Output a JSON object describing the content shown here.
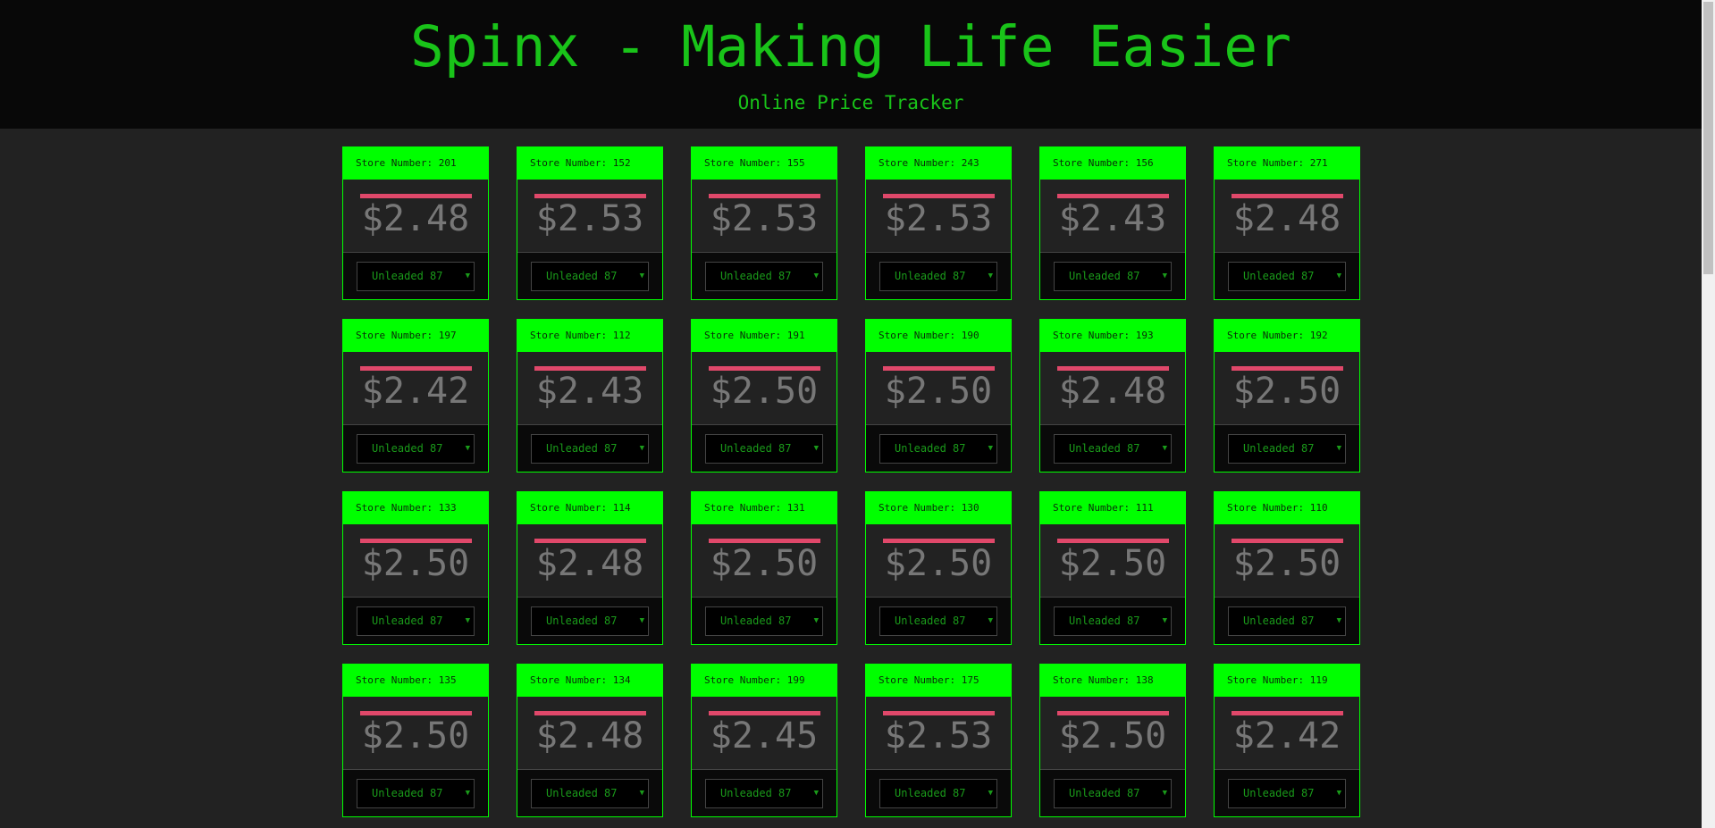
{
  "header": {
    "title": "Spinx - Making Life Easier",
    "subtitle": "Online Price Tracker"
  },
  "colors": {
    "accent": "#00ff00",
    "price_bar": "#e0486a",
    "background": "#222222"
  },
  "store_label": "Store Number: ",
  "stores": [
    {
      "number": "201",
      "price": "$2.48",
      "fuel": "Unleaded 87"
    },
    {
      "number": "152",
      "price": "$2.53",
      "fuel": "Unleaded 87"
    },
    {
      "number": "155",
      "price": "$2.53",
      "fuel": "Unleaded 87"
    },
    {
      "number": "243",
      "price": "$2.53",
      "fuel": "Unleaded 87"
    },
    {
      "number": "156",
      "price": "$2.43",
      "fuel": "Unleaded 87"
    },
    {
      "number": "271",
      "price": "$2.48",
      "fuel": "Unleaded 87"
    },
    {
      "number": "197",
      "price": "$2.42",
      "fuel": "Unleaded 87"
    },
    {
      "number": "112",
      "price": "$2.43",
      "fuel": "Unleaded 87"
    },
    {
      "number": "191",
      "price": "$2.50",
      "fuel": "Unleaded 87"
    },
    {
      "number": "190",
      "price": "$2.50",
      "fuel": "Unleaded 87"
    },
    {
      "number": "193",
      "price": "$2.48",
      "fuel": "Unleaded 87"
    },
    {
      "number": "192",
      "price": "$2.50",
      "fuel": "Unleaded 87"
    },
    {
      "number": "133",
      "price": "$2.50",
      "fuel": "Unleaded 87"
    },
    {
      "number": "114",
      "price": "$2.48",
      "fuel": "Unleaded 87"
    },
    {
      "number": "131",
      "price": "$2.50",
      "fuel": "Unleaded 87"
    },
    {
      "number": "130",
      "price": "$2.50",
      "fuel": "Unleaded 87"
    },
    {
      "number": "111",
      "price": "$2.50",
      "fuel": "Unleaded 87"
    },
    {
      "number": "110",
      "price": "$2.50",
      "fuel": "Unleaded 87"
    },
    {
      "number": "135",
      "price": "$2.50",
      "fuel": "Unleaded 87"
    },
    {
      "number": "134",
      "price": "$2.48",
      "fuel": "Unleaded 87"
    },
    {
      "number": "199",
      "price": "$2.45",
      "fuel": "Unleaded 87"
    },
    {
      "number": "175",
      "price": "$2.53",
      "fuel": "Unleaded 87"
    },
    {
      "number": "138",
      "price": "$2.50",
      "fuel": "Unleaded 87"
    },
    {
      "number": "119",
      "price": "$2.42",
      "fuel": "Unleaded 87"
    }
  ],
  "dropdown_icon": "triangle-down"
}
